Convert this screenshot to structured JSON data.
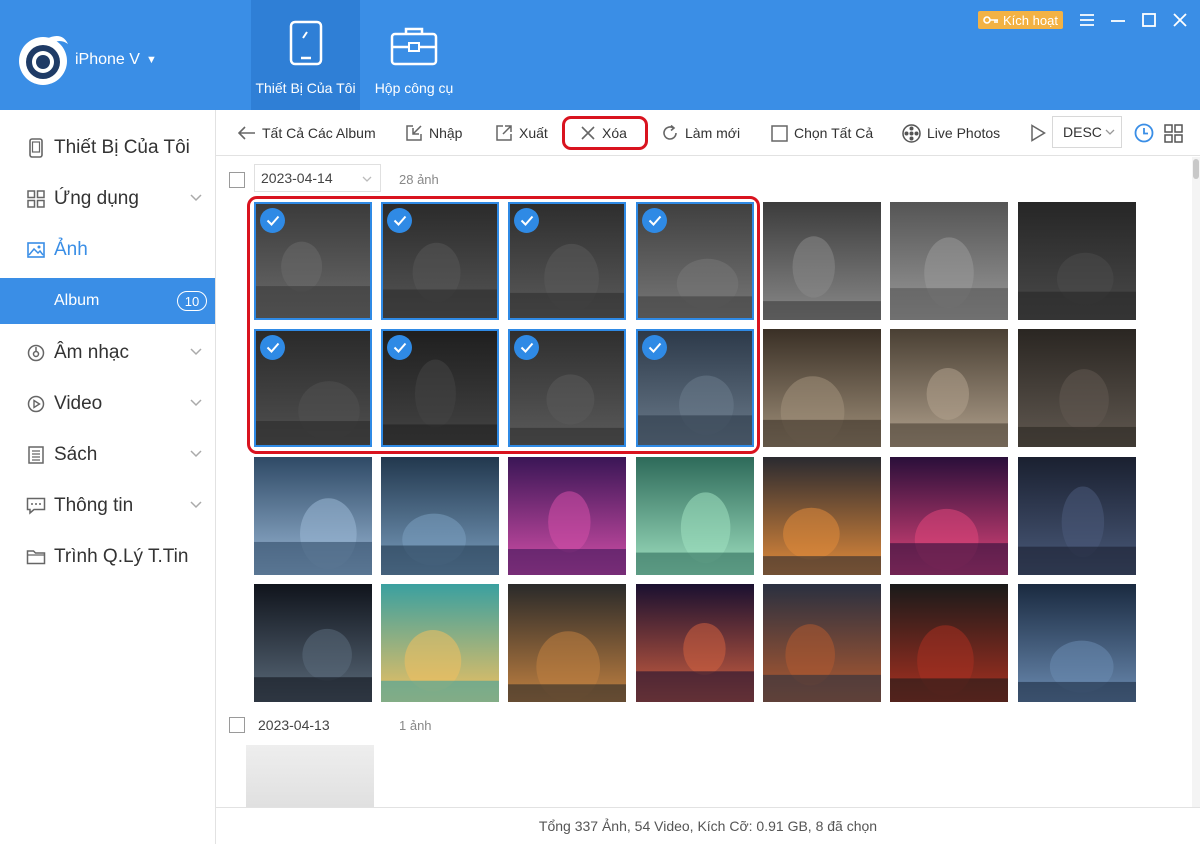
{
  "header": {
    "device_name": "iPhone V",
    "tabs": [
      {
        "label": "Thiết Bị Của Tôi",
        "icon": "tablet-icon",
        "active": true
      },
      {
        "label": "Hộp công cụ",
        "icon": "toolbox-icon",
        "active": false
      }
    ],
    "activate_label": "Kích hoạt",
    "colors": {
      "header": "#3a8ee6",
      "active_tab": "#2f7fd6",
      "activate": "#f3b244"
    }
  },
  "sidebar": {
    "items": [
      {
        "label": "Thiết Bị Của Tôi",
        "icon": "device-icon"
      },
      {
        "label": "Ứng dụng",
        "icon": "apps-grid-icon"
      },
      {
        "label": "Ảnh",
        "icon": "image-icon"
      },
      {
        "label": "Album",
        "badge": "10"
      },
      {
        "label": "Âm nhạc",
        "icon": "music-icon"
      },
      {
        "label": "Video",
        "icon": "video-play-icon"
      },
      {
        "label": "Sách",
        "icon": "book-icon"
      },
      {
        "label": "Thông tin",
        "icon": "message-icon"
      },
      {
        "label": "Trình Q.Lý T.Tin",
        "icon": "folder-icon"
      }
    ]
  },
  "toolbar": {
    "back": "Tất Cả Các Album",
    "import": "Nhập",
    "export": "Xuất",
    "delete": "Xóa",
    "refresh": "Làm mới",
    "select_all": "Chọn Tất Cả",
    "live_photos": "Live Photos",
    "sort": "DESC"
  },
  "groups": [
    {
      "date": "2023-04-14",
      "count": "28 ảnh",
      "selected_photos": 8,
      "visible_photos": 28
    },
    {
      "date": "2023-04-13",
      "count": "1 ảnh"
    }
  ],
  "status": "Tổng 337 Ảnh, 54 Video, Kích Cỡ: 0.91 GB, 8 đã chọn",
  "colors": {
    "accent": "#3a8ee6",
    "highlight": "#d9131f",
    "selected_border": "#2f8ae5"
  }
}
